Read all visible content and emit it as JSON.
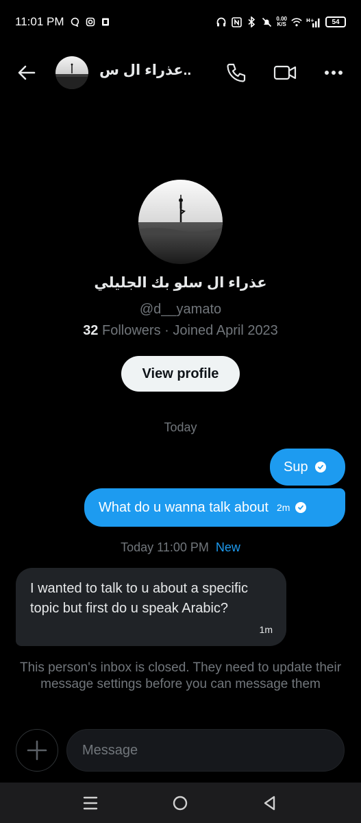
{
  "status_bar": {
    "time": "11:01 PM",
    "net_speed_value": "0.00",
    "net_speed_unit": "K/S",
    "signal_label": "H+",
    "battery": "54",
    "left_icons": [
      "chat-bubble-icon",
      "instagram-icon",
      "office-icon"
    ],
    "right_icons": [
      "headphones-icon",
      "nfc-icon",
      "bluetooth-icon",
      "mute-icon",
      "wifi-icon",
      "signal-icon",
      "battery-icon"
    ]
  },
  "header": {
    "name": "عذراء ال س..",
    "icons": [
      "back-arrow-icon",
      "phone-icon",
      "video-icon",
      "more-icon"
    ]
  },
  "profile": {
    "name": "عذراء ال سلو بك الجليلي",
    "handle": "@d__yamato",
    "followers_count": "32",
    "followers_label": "Followers",
    "joined": "Joined April 2023",
    "view_profile_label": "View profile"
  },
  "conversation": {
    "date_separator": "Today",
    "outgoing": [
      {
        "text": "Sup",
        "time": ""
      },
      {
        "text": "What do u wanna talk about",
        "time": "2m"
      }
    ],
    "new_separator_time": "Today 11:00 PM",
    "new_label": "New",
    "incoming": [
      {
        "text": "I wanted to talk to u about a specific topic but first do u speak Arabic?",
        "time": "1m"
      }
    ],
    "inbox_closed_note": "This person's inbox is closed. They need to update their message settings before you can message them"
  },
  "composer": {
    "placeholder": "Message"
  },
  "nav_bar": {
    "icons": [
      "menu-icon",
      "home-circle-icon",
      "back-triangle-icon"
    ]
  },
  "colors": {
    "accent": "#1d9bf0",
    "background": "#000000",
    "incoming_bubble": "#202327",
    "muted_text": "#71767b"
  }
}
